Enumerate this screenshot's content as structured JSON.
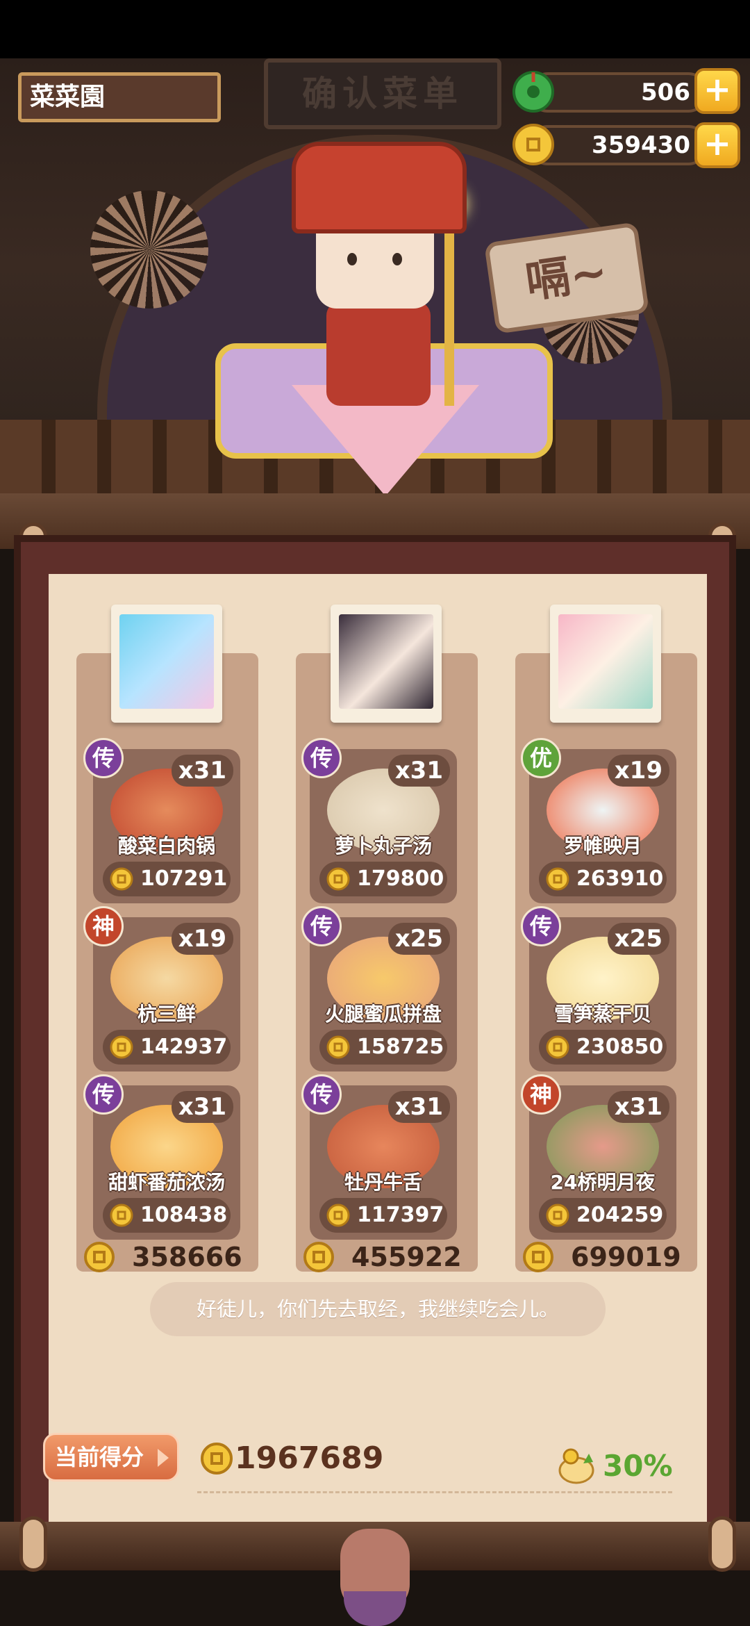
{
  "hud": {
    "shop_name": "菜菜園",
    "jade": "506",
    "coins": "359430",
    "plus_label": "+"
  },
  "scene": {
    "sign_text": "确认菜单",
    "speech": "嗝~"
  },
  "columns": [
    {
      "total": "358666",
      "dishes": [
        {
          "badge": "传",
          "badge_color": "#7b3f9a",
          "name": "酸菜白肉锅",
          "qty": "x31",
          "price": "107291",
          "food_color": "#c0452e"
        },
        {
          "badge": "神",
          "badge_color": "#c2462b",
          "name": "杭三鲜",
          "qty": "x19",
          "price": "142937",
          "food_color": "#e9a14f"
        },
        {
          "badge": "传",
          "badge_color": "#7b3f9a",
          "name": "甜虾番茄浓汤",
          "qty": "x31",
          "price": "108438",
          "food_color": "#f0a23c"
        }
      ]
    },
    {
      "total": "455922",
      "dishes": [
        {
          "badge": "传",
          "badge_color": "#7b3f9a",
          "name": "萝卜丸子汤",
          "qty": "x31",
          "price": "179800",
          "food_color": "#d7c5a8"
        },
        {
          "badge": "传",
          "badge_color": "#7b3f9a",
          "name": "火腿蜜瓜拼盘",
          "qty": "x25",
          "price": "158725",
          "food_color": "#e7a27c"
        },
        {
          "badge": "传",
          "badge_color": "#7b3f9a",
          "name": "牡丹牛舌",
          "qty": "x31",
          "price": "117397",
          "food_color": "#c25a3a"
        }
      ]
    },
    {
      "total": "699019",
      "dishes": [
        {
          "badge": "优",
          "badge_color": "#5fa33a",
          "name": "罗帷映月",
          "qty": "x19",
          "price": "263910",
          "food_color": "#ee6a45"
        },
        {
          "badge": "传",
          "badge_color": "#7b3f9a",
          "name": "雪笋蒸干贝",
          "qty": "x25",
          "price": "230850",
          "food_color": "#f2d790"
        },
        {
          "badge": "神",
          "badge_color": "#c2462b",
          "name": "24桥明月夜",
          "qty": "x31",
          "price": "204259",
          "food_color": "#7a9a56"
        }
      ]
    }
  ],
  "dialog": "好徒儿，你们先去取经，我继续吃会儿。",
  "score": {
    "label": "当前得分",
    "total": "1967689",
    "bonus": "30%"
  },
  "colors": {
    "gold": "#f4c63a",
    "jade": "#3fae4c",
    "bonus_green": "#5aa632"
  }
}
